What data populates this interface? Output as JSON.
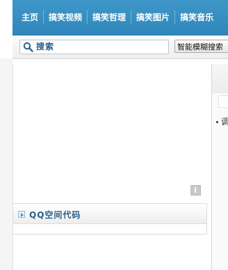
{
  "nav": {
    "items": [
      {
        "label": "主页"
      },
      {
        "label": "搞笑视频"
      },
      {
        "label": "搞笑哲理"
      },
      {
        "label": "搞笑图片"
      },
      {
        "label": "搞笑音乐"
      }
    ]
  },
  "search": {
    "label": "搜索",
    "fuzzy_button": "智能模糊搜索"
  },
  "section": {
    "title": "QQ空间代码"
  },
  "right_panel": {
    "item_label": "调"
  },
  "colors": {
    "nav_bg": "#3490c4",
    "accent_text": "#2a5f8a"
  }
}
